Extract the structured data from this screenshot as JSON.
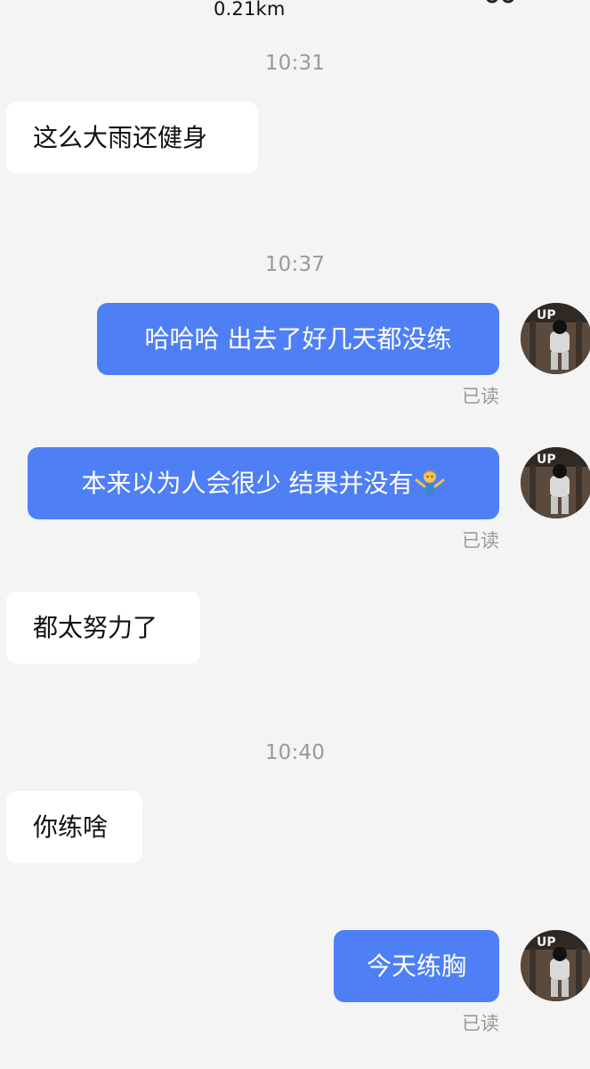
{
  "header": {
    "distance": "0.21km",
    "icon": "glasses-icon"
  },
  "messages": {
    "time_1": "10:31",
    "msg_1": "这么大雨还健身",
    "time_2": "10:37",
    "msg_2": "哈哈哈 出去了好几天都没练",
    "read_2": "已读",
    "msg_3": "本来以为人会很少 结果并没有",
    "read_3": "已读",
    "msg_4": "都太努力了",
    "time_3": "10:40",
    "msg_5": "你练啥",
    "msg_6": "今天练胸",
    "read_6": "已读"
  },
  "colors": {
    "background": "#f4f4f4",
    "incoming_bubble": "#ffffff",
    "outgoing_bubble": "#4f7ff4",
    "time_text": "#9a9a9a"
  },
  "icons": {
    "avatar": "avatar-image",
    "emoji": "shrugging-person-emoji"
  }
}
